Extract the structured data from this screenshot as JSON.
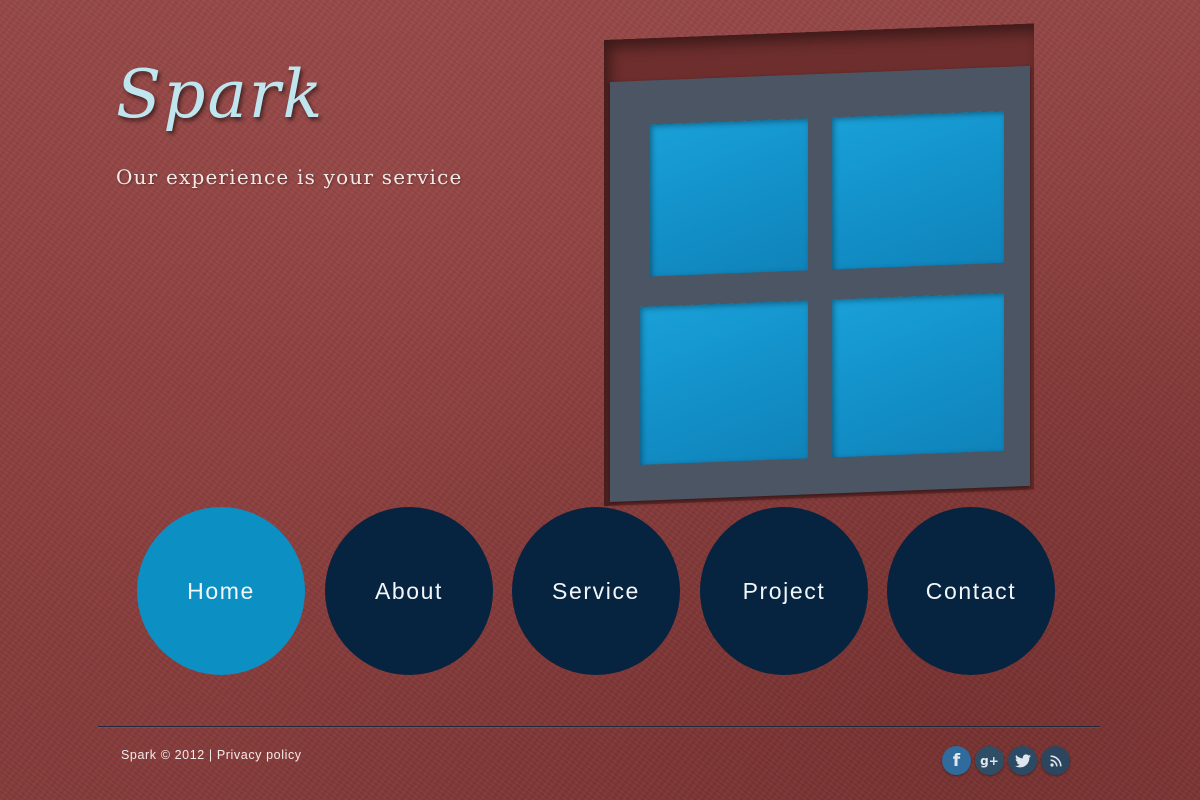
{
  "brand": {
    "logo": "Spark",
    "tagline": "Our experience is your service"
  },
  "nav": {
    "items": [
      {
        "label": "Home",
        "active": true
      },
      {
        "label": "About",
        "active": false
      },
      {
        "label": "Service",
        "active": false
      },
      {
        "label": "Project",
        "active": false
      },
      {
        "label": "Contact",
        "active": false
      }
    ]
  },
  "footer": {
    "copyright": "Spark © 2012",
    "separator": "|",
    "privacy_link": "Privacy policy"
  },
  "social": {
    "facebook_glyph": "f",
    "googleplus_glyph": "g+",
    "icons": [
      "facebook-icon",
      "google-plus-icon",
      "twitter-icon",
      "rss-icon"
    ]
  },
  "colors": {
    "background": "#8b3f3e",
    "logo": "#bfe6ef",
    "nav_default": "#06233f",
    "nav_active": "#0c8fc3",
    "window_glass": "#1391c9"
  }
}
